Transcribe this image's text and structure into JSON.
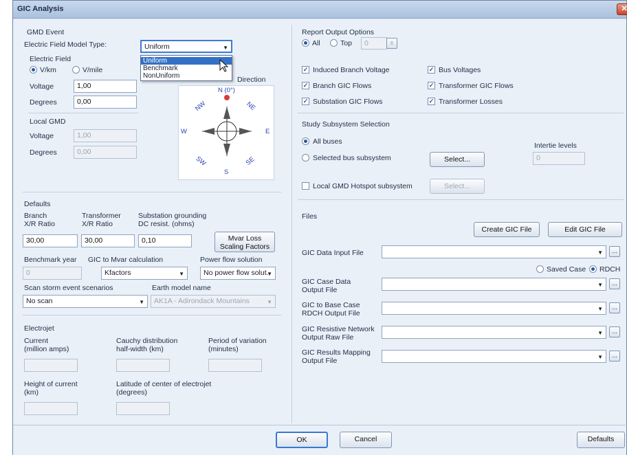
{
  "window": {
    "title": "GIC Analysis",
    "close_glyph": "✕"
  },
  "gmd": {
    "title": "GMD Event",
    "model_type_label": "Electric Field Model Type:",
    "model_type_value": "Uniform",
    "dropdown_options": [
      "Uniform",
      "Benchmark",
      "NonUniform"
    ],
    "efield_label": "Electric Field",
    "unit_vkm": "V/km",
    "unit_vmile": "V/mile",
    "voltage_label": "Voltage",
    "voltage_value": "1,00",
    "degrees_label": "Degrees",
    "degrees_value": "0,00",
    "local_title": "Local GMD",
    "local_voltage_label": "Voltage",
    "local_voltage_value": "1,00",
    "local_degrees_label": "Degrees",
    "local_degrees_value": "0,00",
    "direction_label": "Direction",
    "compass": {
      "n": "N (0°)",
      "ne": "NE",
      "e": "E",
      "se": "SE",
      "s": "S",
      "sw": "SW",
      "w": "W",
      "nw": "NW"
    }
  },
  "defaults": {
    "title": "Defaults",
    "branch_label": "Branch\nX/R Ratio",
    "branch_l1": "Branch",
    "branch_l2": "X/R Ratio",
    "branch_value": "30,00",
    "transformer_l1": "Transformer",
    "transformer_l2": "X/R Ratio",
    "transformer_value": "30,00",
    "substation_l1": "Substation grounding",
    "substation_l2": "DC resist. (ohms)",
    "substation_value": "0,10",
    "mvar_btn_l1": "Mvar Loss",
    "mvar_btn_l2": "Scaling Factors",
    "bench_year_label": "Benchmark year",
    "bench_year_value": "0",
    "gic_mvar_label": "GIC to Mvar calculation",
    "gic_mvar_value": "Kfactors",
    "powerflow_label": "Power flow solution",
    "powerflow_value": "No power flow solut.",
    "scan_label": "Scan storm event scenarios",
    "scan_value": "No scan",
    "earth_label": "Earth model name",
    "earth_value": "AK1A - Adirondack Mountains"
  },
  "electrojet": {
    "title": "Electrojet",
    "current_l1": "Current",
    "current_l2": "(million amps)",
    "cauchy_l1": "Cauchy distribution",
    "cauchy_l2": "half-width (km)",
    "period_l1": "Period of variation",
    "period_l2": "(minutes)",
    "height_l1": "Height of current",
    "height_l2": "(km)",
    "latitude_l1": "Latitude of center of electrojet",
    "latitude_l2": "(degrees)"
  },
  "report": {
    "title": "Report Output Options",
    "all": "All",
    "top": "Top",
    "top_value": "0",
    "checks": [
      "Induced Branch Voltage",
      "Bus Voltages",
      "Branch GIC Flows",
      "Transformer GIC Flows",
      "Substation GIC Flows",
      "Transformer Losses"
    ]
  },
  "study": {
    "title": "Study Subsystem Selection",
    "all_buses": "All buses",
    "selected": "Selected bus subsystem",
    "select_btn": "Select...",
    "intertie_label": "Intertie levels",
    "intertie_value": "0",
    "hotspot": "Local GMD Hotspot subsystem",
    "hotspot_btn": "Select..."
  },
  "files": {
    "title": "Files",
    "create_btn": "Create GIC File",
    "edit_btn": "Edit GIC File",
    "input_label": "GIC Data Input File",
    "saved_case": "Saved Case",
    "rdch": "RDCH",
    "case_l1": "GIC Case Data",
    "case_l2": "Output File",
    "base_l1": "GIC to Base Case",
    "base_l2": "RDCH Output File",
    "resist_l1": "GIC Resistive Network",
    "resist_l2": "Output Raw File",
    "map_l1": "GIC Results Mapping",
    "map_l2": "Output File",
    "browse": "..."
  },
  "footer": {
    "ok": "OK",
    "cancel": "Cancel",
    "defaults": "Defaults"
  }
}
